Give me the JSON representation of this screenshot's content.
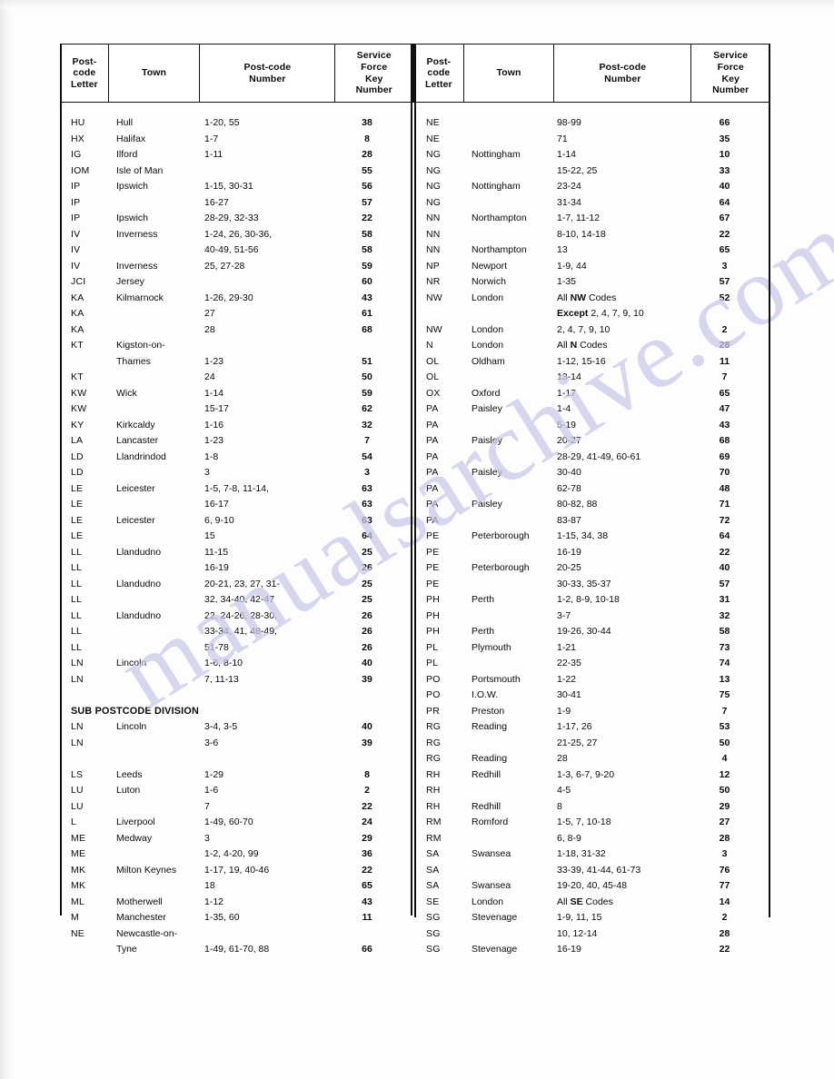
{
  "document": {
    "watermark_text": "manualsarchive.com"
  },
  "table": {
    "headers": {
      "letter": "Post-\ncode\nLetter",
      "letter_lines": [
        "Post-",
        "code",
        "Letter"
      ],
      "town": "Town",
      "number_lines": [
        "Post-code",
        "Number"
      ],
      "key_lines": [
        "Service",
        "Force",
        "Key",
        "Number"
      ]
    },
    "section_heading": "SUB POSTCODE DIVISION",
    "left_rows": [
      {
        "letter": "HU",
        "town": "Hull",
        "number": "1-20, 55",
        "key": "38"
      },
      {
        "letter": "HX",
        "town": "Halifax",
        "number": "1-7",
        "key": "8"
      },
      {
        "letter": "IG",
        "town": "Ilford",
        "number": "1-11",
        "key": "28"
      },
      {
        "letter": "IOM",
        "town": "Isle of Man",
        "number": "",
        "key": "55"
      },
      {
        "letter": "IP",
        "town": "Ipswich",
        "number": "1-15, 30-31",
        "key": "56"
      },
      {
        "letter": "IP",
        "town": "",
        "number": "16-27",
        "key": "57"
      },
      {
        "letter": "IP",
        "town": "Ipswich",
        "number": "28-29, 32-33",
        "key": "22"
      },
      {
        "letter": "IV",
        "town": "Inverness",
        "number": "1-24, 26, 30-36,",
        "key": "58"
      },
      {
        "letter": "IV",
        "town": "",
        "number": "40-49, 51-56",
        "key": "58"
      },
      {
        "letter": "IV",
        "town": "Inverness",
        "number": "25, 27-28",
        "key": "59"
      },
      {
        "letter": "JCI",
        "town": "Jersey",
        "number": "",
        "key": "60"
      },
      {
        "letter": "KA",
        "town": "Kilmarnock",
        "number": "1-26, 29-30",
        "key": "43"
      },
      {
        "letter": "KA",
        "town": "",
        "number": "27",
        "key": "61"
      },
      {
        "letter": "KA",
        "town": "",
        "number": "28",
        "key": "68"
      },
      {
        "letter": "KT",
        "town": "Kigston-on-",
        "number": "",
        "key": ""
      },
      {
        "letter": "",
        "town": "Thames",
        "number": "1-23",
        "key": "51"
      },
      {
        "letter": "KT",
        "town": "",
        "number": "24",
        "key": "50"
      },
      {
        "letter": "KW",
        "town": "Wick",
        "number": "1-14",
        "key": "59"
      },
      {
        "letter": "KW",
        "town": "",
        "number": "15-17",
        "key": "62"
      },
      {
        "letter": "KY",
        "town": "Kirkcaldy",
        "number": "1-16",
        "key": "32"
      },
      {
        "letter": "LA",
        "town": "Lancaster",
        "number": "1-23",
        "key": "7"
      },
      {
        "letter": "LD",
        "town": "Llandrindod",
        "number": "1-8",
        "key": "54"
      },
      {
        "letter": "LD",
        "town": "",
        "number": "3",
        "key": "3"
      },
      {
        "letter": "LE",
        "town": "Leicester",
        "number": "1-5, 7-8, 11-14,",
        "key": "63"
      },
      {
        "letter": "LE",
        "town": "",
        "number": "16-17",
        "key": "63"
      },
      {
        "letter": "LE",
        "town": "Leicester",
        "number": "6, 9-10",
        "key": "63"
      },
      {
        "letter": "LE",
        "town": "",
        "number": "15",
        "key": "64"
      },
      {
        "letter": "LL",
        "town": "Llandudno",
        "number": "11-15",
        "key": "25"
      },
      {
        "letter": "LL",
        "town": "",
        "number": "16-19",
        "key": "26"
      },
      {
        "letter": "LL",
        "town": "Llandudno",
        "number": "20-21, 23, 27, 31-",
        "key": "25"
      },
      {
        "letter": "LL",
        "town": "",
        "number": "32, 34-40, 42-47",
        "key": "25"
      },
      {
        "letter": "LL",
        "town": "Llandudno",
        "number": "22, 24-26, 28-30,",
        "key": "26"
      },
      {
        "letter": "LL",
        "town": "",
        "number": "33-34, 41, 48-49,",
        "key": "26"
      },
      {
        "letter": "LL",
        "town": "",
        "number": "51-78",
        "key": "26"
      },
      {
        "letter": "LN",
        "town": "Lincoln",
        "number": "1-6, 8-10",
        "key": "40"
      },
      {
        "letter": "LN",
        "town": "",
        "number": "7, 11-13",
        "key": "39"
      }
    ],
    "left_rows_after_section": [
      {
        "letter": "LN",
        "town": "Lincoln",
        "number": "3-4, 3-5",
        "key": "40"
      },
      {
        "letter": "LN",
        "town": "",
        "number": "3-6",
        "key": "39"
      },
      {
        "letter": "",
        "town": "",
        "number": "",
        "key": ""
      },
      {
        "letter": "LS",
        "town": "Leeds",
        "number": "1-29",
        "key": "8"
      },
      {
        "letter": "LU",
        "town": "Luton",
        "number": "1-6",
        "key": "2"
      },
      {
        "letter": "LU",
        "town": "",
        "number": "7",
        "key": "22"
      },
      {
        "letter": "L",
        "town": "Liverpool",
        "number": "1-49, 60-70",
        "key": "24"
      },
      {
        "letter": "ME",
        "town": "Medway",
        "number": "3",
        "key": "29"
      },
      {
        "letter": "ME",
        "town": "",
        "number": "1-2, 4-20, 99",
        "key": "36"
      },
      {
        "letter": "MK",
        "town": "Milton Keynes",
        "number": "1-17, 19, 40-46",
        "key": "22"
      },
      {
        "letter": "MK",
        "town": "",
        "number": "18",
        "key": "65"
      },
      {
        "letter": "ML",
        "town": "Motherwell",
        "number": "1-12",
        "key": "43"
      },
      {
        "letter": "M",
        "town": "Manchester",
        "number": "1-35, 60",
        "key": "11"
      },
      {
        "letter": "NE",
        "town": "Newcastle-on-",
        "number": "",
        "key": ""
      },
      {
        "letter": "",
        "town": "Tyne",
        "number": "1-49, 61-70, 88",
        "key": "66"
      }
    ],
    "right_rows": [
      {
        "letter": "NE",
        "town": "",
        "number": "98-99",
        "key": "66"
      },
      {
        "letter": "NE",
        "town": "",
        "number": "71",
        "key": "35"
      },
      {
        "letter": "NG",
        "town": "Nottingham",
        "number": "1-14",
        "key": "10"
      },
      {
        "letter": "NG",
        "town": "",
        "number": "15-22, 25",
        "key": "33"
      },
      {
        "letter": "NG",
        "town": "Nottingham",
        "number": "23-24",
        "key": "40"
      },
      {
        "letter": "NG",
        "town": "",
        "number": "31-34",
        "key": "64"
      },
      {
        "letter": "NN",
        "town": "Northampton",
        "number": "1-7, 11-12",
        "key": "67"
      },
      {
        "letter": "NN",
        "town": "",
        "number": "8-10, 14-18",
        "key": "22"
      },
      {
        "letter": "NN",
        "town": "Northampton",
        "number": "13",
        "key": "65"
      },
      {
        "letter": "NP",
        "town": "Newport",
        "number": "1-9, 44",
        "key": "3"
      },
      {
        "letter": "NR",
        "town": "Norwich",
        "number": "1-35",
        "key": "57"
      },
      {
        "letter": "NW",
        "town": "London",
        "number": "All NW Codes",
        "key": "52",
        "bold_span": "NW"
      },
      {
        "letter": "",
        "town": "",
        "number": "Except 2, 4, 7, 9, 10",
        "key": "",
        "bold_span": "Except"
      },
      {
        "letter": "NW",
        "town": "London",
        "number": "2, 4, 7, 9, 10",
        "key": "2"
      },
      {
        "letter": "N",
        "town": "London",
        "number": "All N Codes",
        "key": "28",
        "bold_span": "N"
      },
      {
        "letter": "OL",
        "town": "Oldham",
        "number": "1-12, 15-16",
        "key": "11"
      },
      {
        "letter": "OL",
        "town": "",
        "number": "13-14",
        "key": "7"
      },
      {
        "letter": "OX",
        "town": "Oxford",
        "number": "1-17",
        "key": "65"
      },
      {
        "letter": "PA",
        "town": "Paisley",
        "number": "1-4",
        "key": "47"
      },
      {
        "letter": "PA",
        "town": "",
        "number": "5-19",
        "key": "43"
      },
      {
        "letter": "PA",
        "town": "Paisley",
        "number": "20-27",
        "key": "68"
      },
      {
        "letter": "PA",
        "town": "",
        "number": "28-29, 41-49, 60-61",
        "key": "69"
      },
      {
        "letter": "PA",
        "town": "Paisley",
        "number": "30-40",
        "key": "70"
      },
      {
        "letter": "PA",
        "town": "",
        "number": "62-78",
        "key": "48"
      },
      {
        "letter": "PA",
        "town": "Paisley",
        "number": "80-82, 88",
        "key": "71"
      },
      {
        "letter": "PA",
        "town": "",
        "number": "83-87",
        "key": "72"
      },
      {
        "letter": "PE",
        "town": "Peterborough",
        "number": "1-15, 34, 38",
        "key": "64"
      },
      {
        "letter": "PE",
        "town": "",
        "number": "16-19",
        "key": "22"
      },
      {
        "letter": "PE",
        "town": "Peterborough",
        "number": "20-25",
        "key": "40"
      },
      {
        "letter": "PE",
        "town": "",
        "number": "30-33, 35-37",
        "key": "57"
      },
      {
        "letter": "PH",
        "town": "Perth",
        "number": "1-2, 8-9, 10-18",
        "key": "31"
      },
      {
        "letter": "PH",
        "town": "",
        "number": "3-7",
        "key": "32"
      },
      {
        "letter": "PH",
        "town": "Perth",
        "number": "19-26, 30-44",
        "key": "58"
      },
      {
        "letter": "PL",
        "town": "Plymouth",
        "number": "1-21",
        "key": "73"
      },
      {
        "letter": "PL",
        "town": "",
        "number": "22-35",
        "key": "74"
      },
      {
        "letter": "PO",
        "town": "Portsmouth",
        "number": "1-22",
        "key": "13"
      },
      {
        "letter": "PO",
        "town": "I.O.W.",
        "number": "30-41",
        "key": "75"
      },
      {
        "letter": "PR",
        "town": "Preston",
        "number": "1-9",
        "key": "7"
      },
      {
        "letter": "RG",
        "town": "Reading",
        "number": "1-17, 26",
        "key": "53"
      },
      {
        "letter": "RG",
        "town": "",
        "number": "21-25, 27",
        "key": "50"
      },
      {
        "letter": "RG",
        "town": "Reading",
        "number": "28",
        "key": "4"
      },
      {
        "letter": "RH",
        "town": "Redhill",
        "number": "1-3, 6-7, 9-20",
        "key": "12"
      },
      {
        "letter": "RH",
        "town": "",
        "number": "4-5",
        "key": "50"
      },
      {
        "letter": "RH",
        "town": "Redhill",
        "number": "8",
        "key": "29"
      },
      {
        "letter": "RM",
        "town": "Romford",
        "number": "1-5, 7, 10-18",
        "key": "27"
      },
      {
        "letter": "RM",
        "town": "",
        "number": "6, 8-9",
        "key": "28"
      },
      {
        "letter": "SA",
        "town": "Swansea",
        "number": "1-18, 31-32",
        "key": "3"
      },
      {
        "letter": "SA",
        "town": "",
        "number": "33-39, 41-44, 61-73",
        "key": "76"
      },
      {
        "letter": "SA",
        "town": "Swansea",
        "number": "19-20, 40, 45-48",
        "key": "77"
      },
      {
        "letter": "SE",
        "town": "London",
        "number": "All SE Codes",
        "key": "14",
        "bold_span": "SE"
      },
      {
        "letter": "SG",
        "town": "Stevenage",
        "number": "1-9, 11, 15",
        "key": "2"
      },
      {
        "letter": "SG",
        "town": "",
        "number": "10, 12-14",
        "key": "28"
      },
      {
        "letter": "SG",
        "town": "Stevenage",
        "number": "16-19",
        "key": "22"
      }
    ]
  }
}
